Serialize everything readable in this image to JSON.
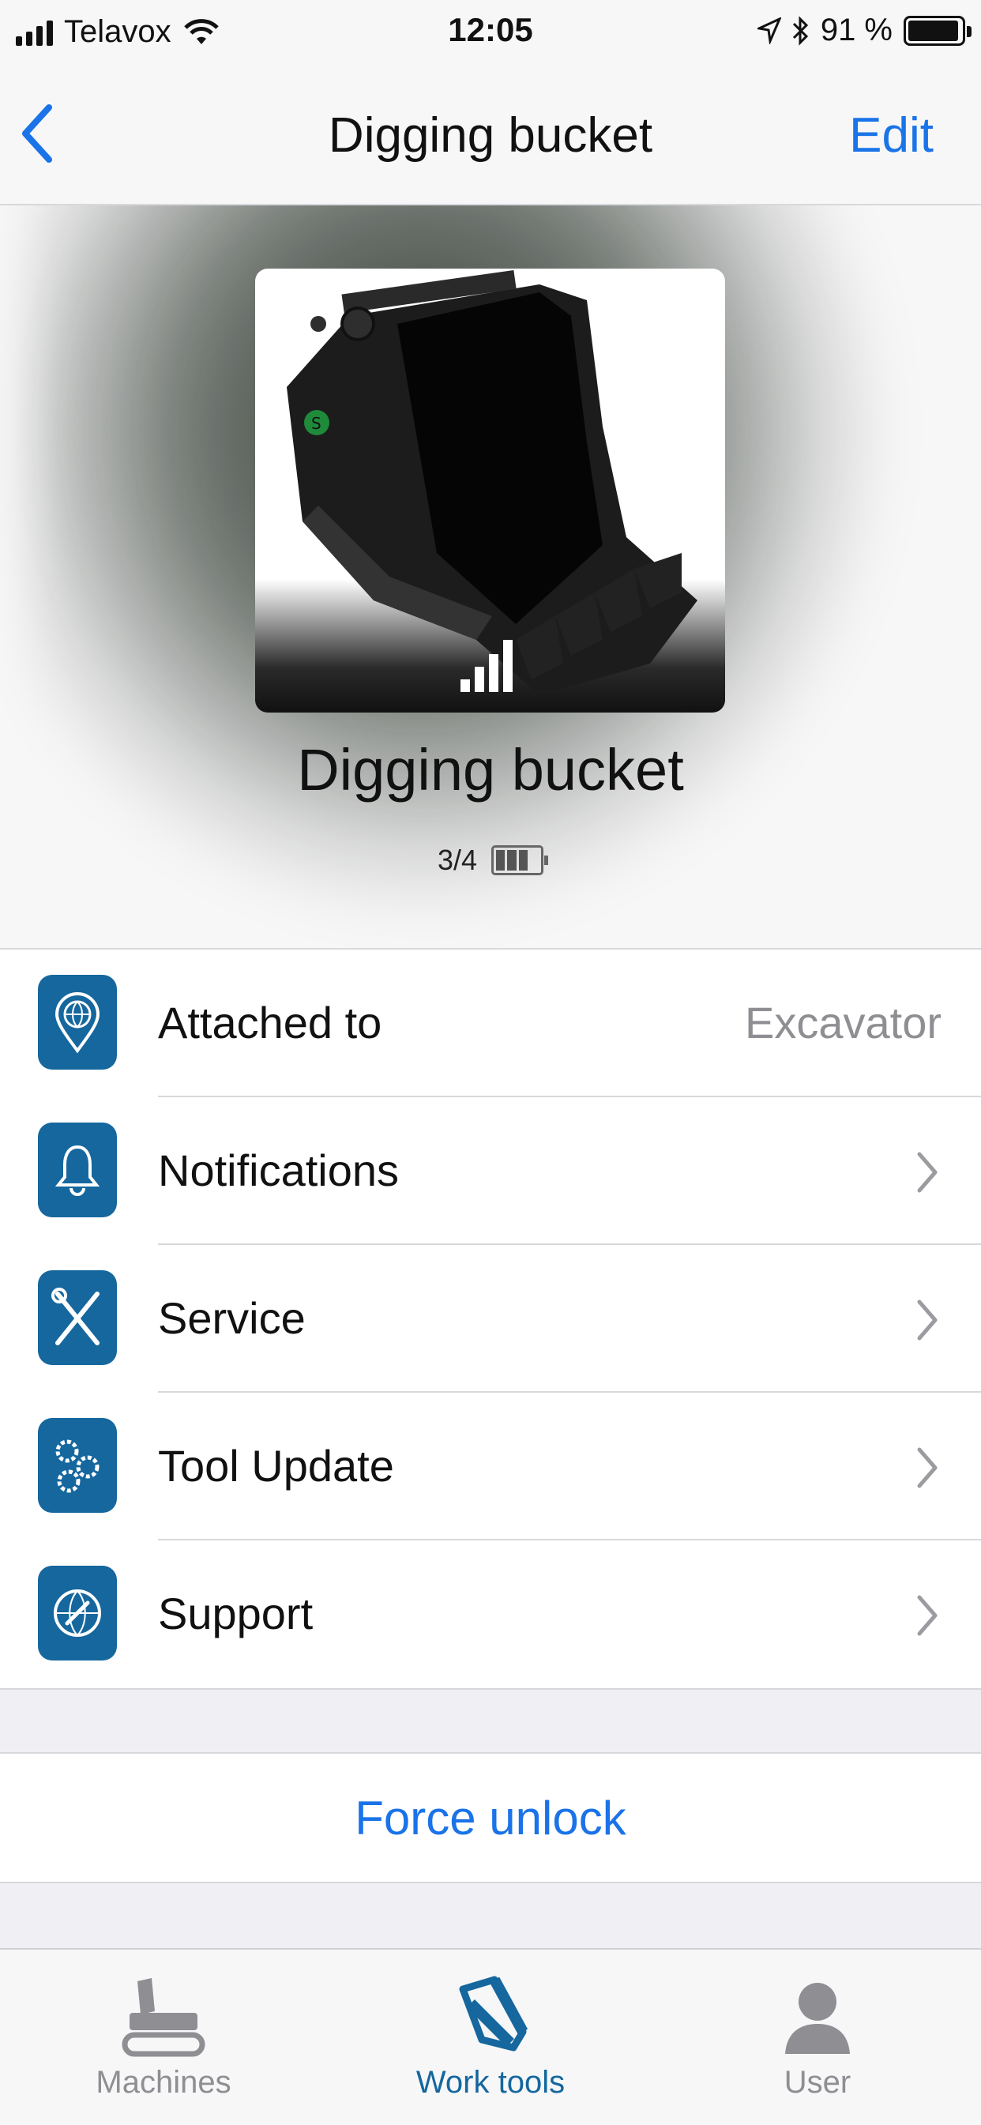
{
  "status_bar": {
    "carrier": "Telavox",
    "time": "12:05",
    "battery_percent": "91 %"
  },
  "nav": {
    "title": "Digging bucket",
    "edit_label": "Edit"
  },
  "tool": {
    "name": "Digging bucket",
    "battery_level": "3/4"
  },
  "list": {
    "items": [
      {
        "label": "Attached to",
        "value": "Excavator",
        "icon": "location-globe-icon"
      },
      {
        "label": "Notifications",
        "icon": "bell-icon"
      },
      {
        "label": "Service",
        "icon": "wrench-screwdriver-icon"
      },
      {
        "label": "Tool Update",
        "icon": "gears-icon"
      },
      {
        "label": "Support",
        "icon": "support-globe-icon"
      }
    ]
  },
  "force_unlock_label": "Force unlock",
  "tabbar": {
    "tabs": [
      {
        "label": "Machines",
        "icon": "excavator-icon",
        "active": false
      },
      {
        "label": "Work tools",
        "icon": "bucket-icon",
        "active": true
      },
      {
        "label": "User",
        "icon": "user-icon",
        "active": false
      }
    ]
  },
  "colors": {
    "accent": "#1a73e8",
    "brand": "#15679e",
    "secondary_text": "#8e8e93"
  }
}
